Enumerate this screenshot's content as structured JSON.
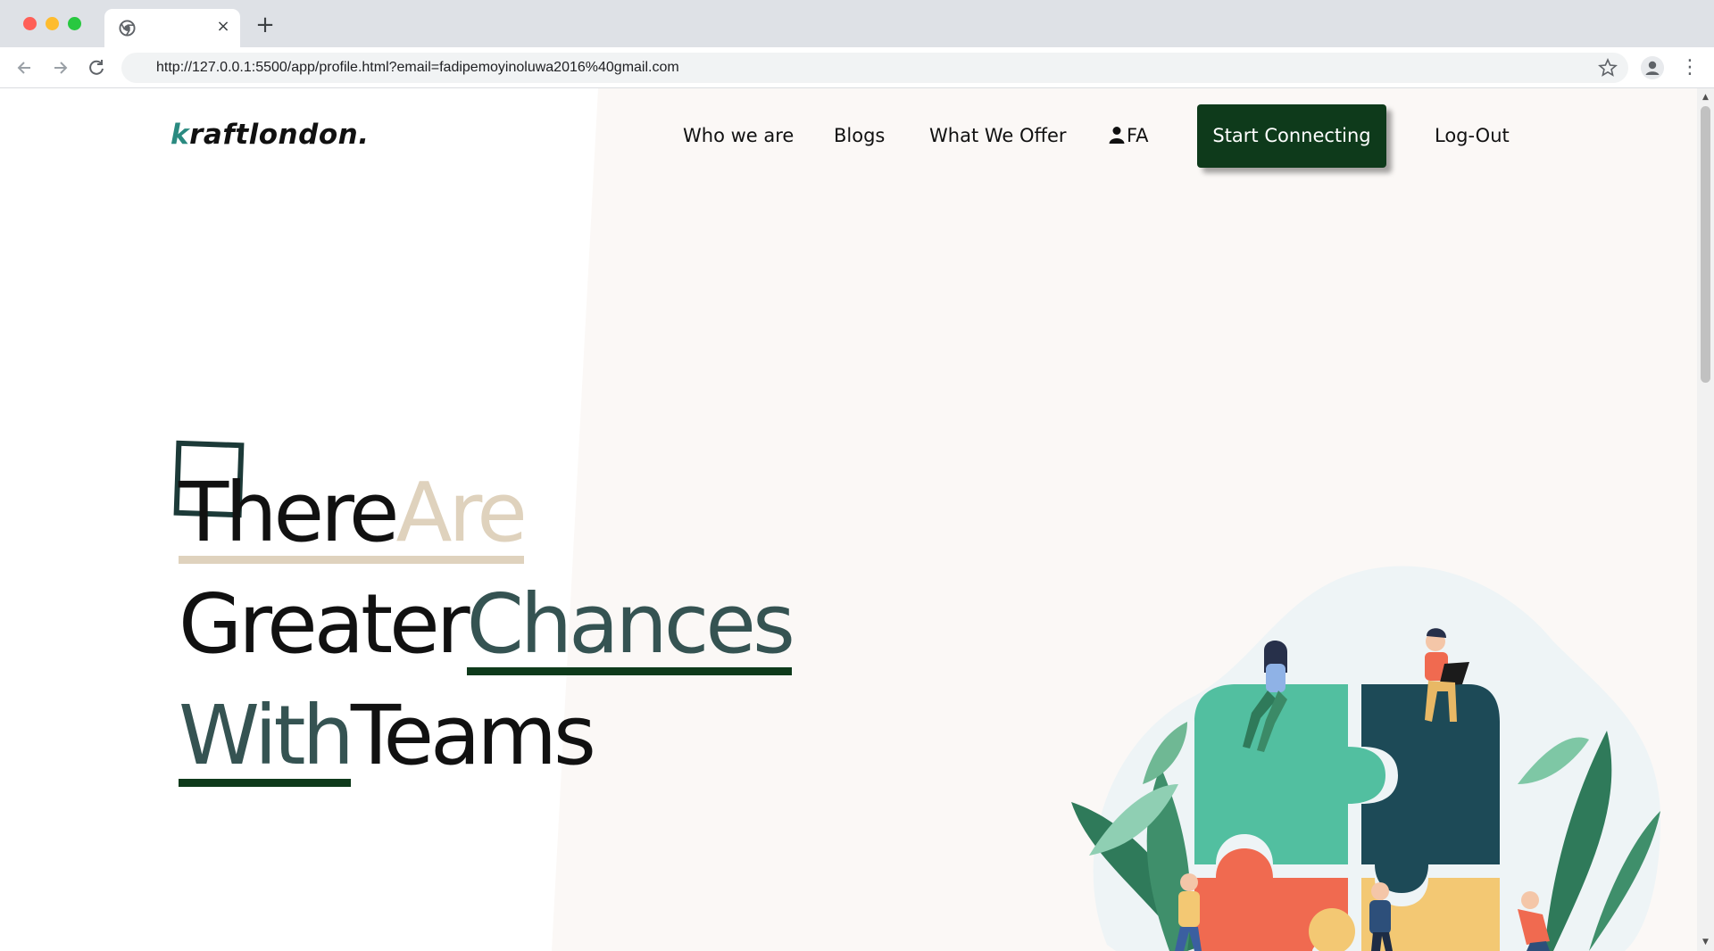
{
  "browser": {
    "url": "http://127.0.0.1:5500/app/profile.html?email=fadipemoyinoluwa2016%40gmail.com",
    "tab_close": "×",
    "new_tab": "+"
  },
  "nav": {
    "logo": "kraftlondon.",
    "links": [
      "Who we are",
      "Blogs",
      "What We Offer"
    ],
    "user_initials": "FA",
    "cta": "Start Connecting",
    "logout": "Log-Out"
  },
  "hero": {
    "line1": [
      "There",
      "Are"
    ],
    "line2": [
      "Greater",
      "Chances"
    ],
    "line3": [
      "With",
      "Teams"
    ]
  },
  "colors": {
    "cta_bg": "#0e3a1b",
    "logo_accent": "#2a8a80",
    "tan": "#dfd2bd",
    "teal_text": "#355352",
    "puzzle_green": "#4fbf9f",
    "puzzle_navy": "#1d4a57",
    "puzzle_orange": "#f06a50",
    "puzzle_yellow": "#f3c873"
  },
  "icons": [
    "chrome-icon",
    "back-arrow-icon",
    "forward-arrow-icon",
    "reload-icon",
    "star-icon",
    "profile-icon",
    "menu-dots-icon",
    "user-icon"
  ]
}
